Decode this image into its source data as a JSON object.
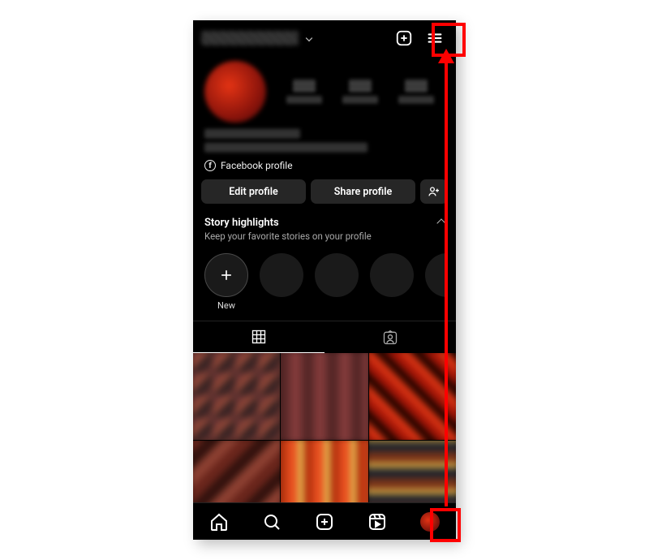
{
  "header": {
    "create_label": "Create",
    "menu_label": "Menu"
  },
  "fb_link_label": "Facebook profile",
  "actions": {
    "edit": "Edit profile",
    "share": "Share profile",
    "discover": "Discover people"
  },
  "highlights": {
    "title": "Story highlights",
    "subtitle": "Keep your favorite stories on your profile",
    "new_label": "New"
  },
  "tabs": {
    "grid": "Posts grid",
    "tagged": "Tagged"
  },
  "bottomnav": {
    "home": "Home",
    "search": "Search",
    "create": "Create",
    "reels": "Reels",
    "profile": "Profile"
  },
  "annotations": {
    "menu_highlight": "Hamburger menu highlighted",
    "profile_highlight": "Profile tab highlighted",
    "arrow": "Arrow from profile tab to menu"
  }
}
